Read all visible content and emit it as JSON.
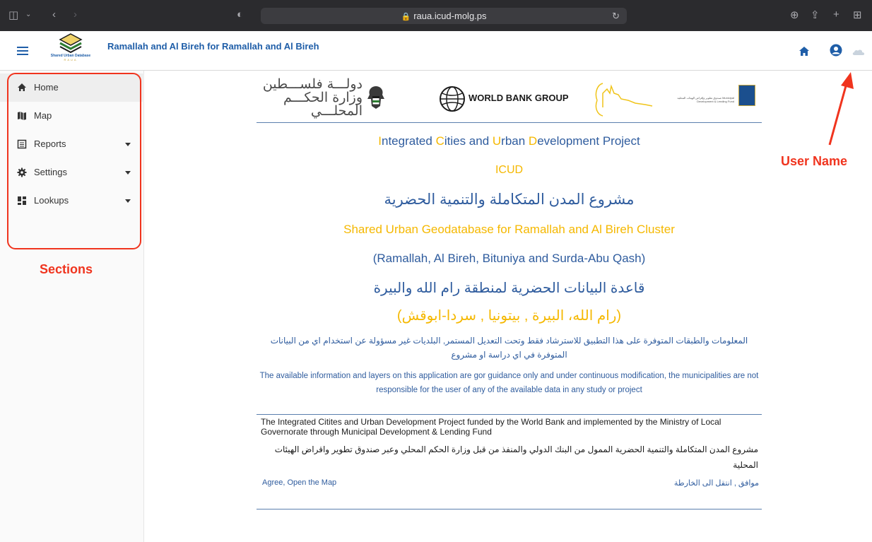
{
  "browser": {
    "url": "raua.icud-molg.ps"
  },
  "header": {
    "logo_title": "Shared Urban Database",
    "logo_sub": "RAUA",
    "app_title": "Ramallah and Al Bireh for Ramallah and Al Bireh",
    "icons": [
      "home-icon",
      "user-circle-icon",
      "cloud-icon"
    ]
  },
  "sidebar": {
    "items": [
      {
        "label": "Home",
        "icon": "home-icon",
        "active": true
      },
      {
        "label": "Map",
        "icon": "map-icon"
      },
      {
        "label": "Reports",
        "icon": "report-icon",
        "expandable": true
      },
      {
        "label": "Settings",
        "icon": "gear-icon",
        "expandable": true
      },
      {
        "label": "Lookups",
        "icon": "grid-icon",
        "expandable": true
      }
    ]
  },
  "annotations": {
    "sections": "Sections",
    "user_name": "User Name"
  },
  "banner": {
    "arabic_line1": "دولـــة فلســـطين",
    "arabic_line2": "وزارة الحكـــم المحلـــي",
    "world_bank": "WORLD BANK GROUP",
    "mdlf": "صندوق تطوير وإقراض الهيئات المحلية Municipal Development & Lending Fund"
  },
  "content": {
    "title_parts": [
      "I",
      "ntegrated ",
      "C",
      "ities and ",
      "U",
      "rban ",
      "D",
      "evelopment Project"
    ],
    "acronym": "ICUD",
    "title_ar": "مشروع المدن المتكاملة والتنمية الحضرية",
    "subtitle_en": "Shared Urban Geodatabase for Ramallah and Al Bireh Cluster",
    "cluster_en": "(Ramallah, Al Bireh, Bituniya and Surda-Abu Qash)",
    "subtitle_ar": "قاعدة البيانات الحضرية لمنطقة رام الله والبيرة",
    "cluster_ar": "(رام الله، البيرة , بيتونيا , سردا-ابوقش)",
    "disclaimer_ar": "المعلومات والطبقات المتوفرة على هذا التطبيق للاسترشاد فقط وتحت التعديل المستمر, البلديات غير مسؤولة عن استخدام اي من البيانات المتوفرة في اي دراسة او مشروع",
    "disclaimer_en": "The available information and layers on this application are gor guidance only and under continuous modification, the municipalities are not responsible for the user of any of the available data in any study or project"
  },
  "footer": {
    "funding_en": "The Integrated Citites and Urban Development Project funded by the World Bank and implemented by the Ministry of Local Governorate through Municipal Development & Lending Fund",
    "funding_ar": "مشروع المدن المتكاملة والتنمية الحضرية الممول من البنك الدولي والمنفذ من قبل وزارة الحكم المحلي وعبر صندوق تطوير واقراض الهيئات المحلية",
    "agree_en": "Agree, Open the Map",
    "agree_ar": "موافق , انتقل الى الخارطة"
  },
  "colors": {
    "brand_blue": "#1f5ea8",
    "title_blue": "#2f5c9e",
    "accent_yellow": "#f5b800",
    "annotation_red": "#f0341e"
  }
}
